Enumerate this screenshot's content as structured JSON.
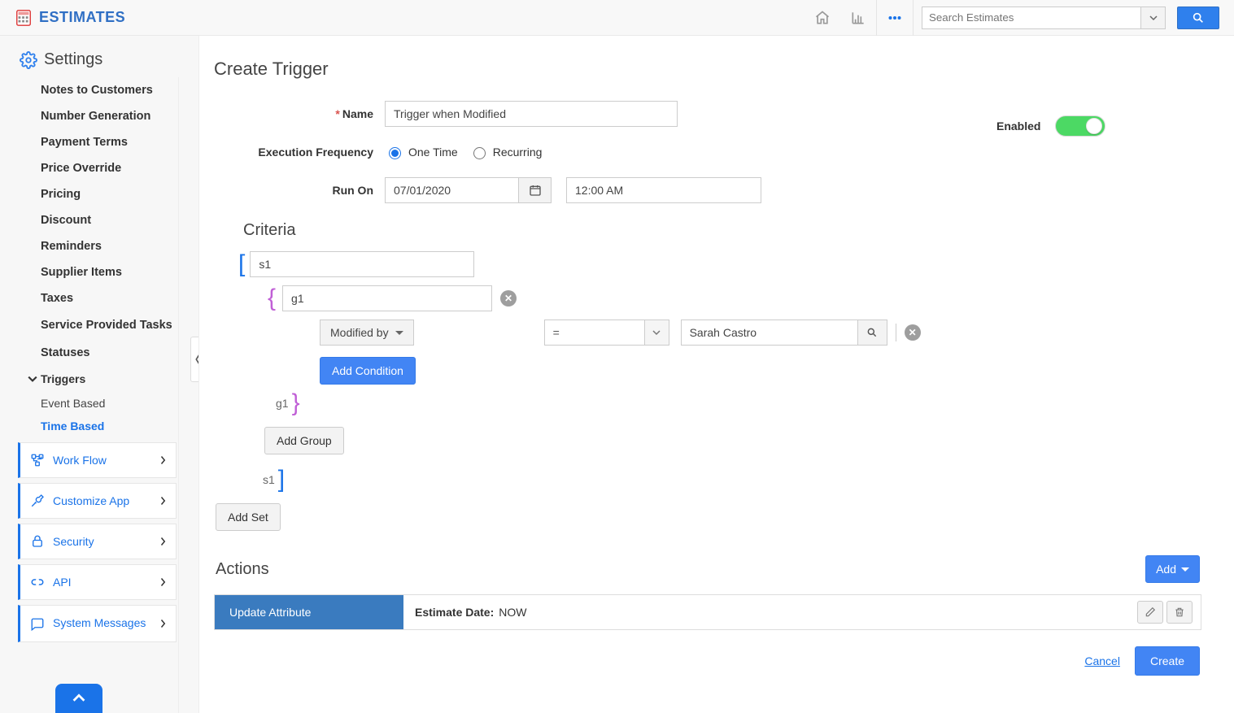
{
  "brand": {
    "name": "ESTIMATES"
  },
  "header": {
    "search_placeholder": "Search Estimates"
  },
  "sidebar": {
    "settings_label": "Settings",
    "items": [
      "Notes to Customers",
      "Number Generation",
      "Payment Terms",
      "Price Override",
      "Pricing",
      "Discount",
      "Reminders",
      "Supplier Items",
      "Taxes",
      "Service Provided Tasks",
      "Statuses"
    ],
    "triggers": {
      "label": "Triggers",
      "children": {
        "event_based": "Event Based",
        "time_based": "Time Based"
      }
    },
    "boxes": {
      "workflow": "Work Flow",
      "customize": "Customize App",
      "security": "Security",
      "api": "API",
      "system_messages": "System Messages"
    }
  },
  "page": {
    "title": "Create Trigger"
  },
  "form": {
    "name_label": "Name",
    "name_value": "Trigger when Modified",
    "enabled_label": "Enabled",
    "enabled": true,
    "freq_label": "Execution Frequency",
    "freq_options": {
      "one_time": "One Time",
      "recurring": "Recurring"
    },
    "freq_selected": "one_time",
    "run_on_label": "Run On",
    "run_on_date": "07/01/2020",
    "run_on_time": "12:00 AM"
  },
  "criteria": {
    "heading": "Criteria",
    "set_name": "s1",
    "group_name": "g1",
    "condition": {
      "field": "Modified by",
      "operator": "=",
      "value": "Sarah Castro"
    },
    "add_condition_label": "Add Condition",
    "add_group_label": "Add Group",
    "add_set_label": "Add Set"
  },
  "actions": {
    "heading": "Actions",
    "add_label": "Add",
    "row": {
      "type": "Update Attribute",
      "attr_label": "Estimate Date:",
      "value": "NOW"
    }
  },
  "footer": {
    "cancel": "Cancel",
    "create": "Create"
  }
}
